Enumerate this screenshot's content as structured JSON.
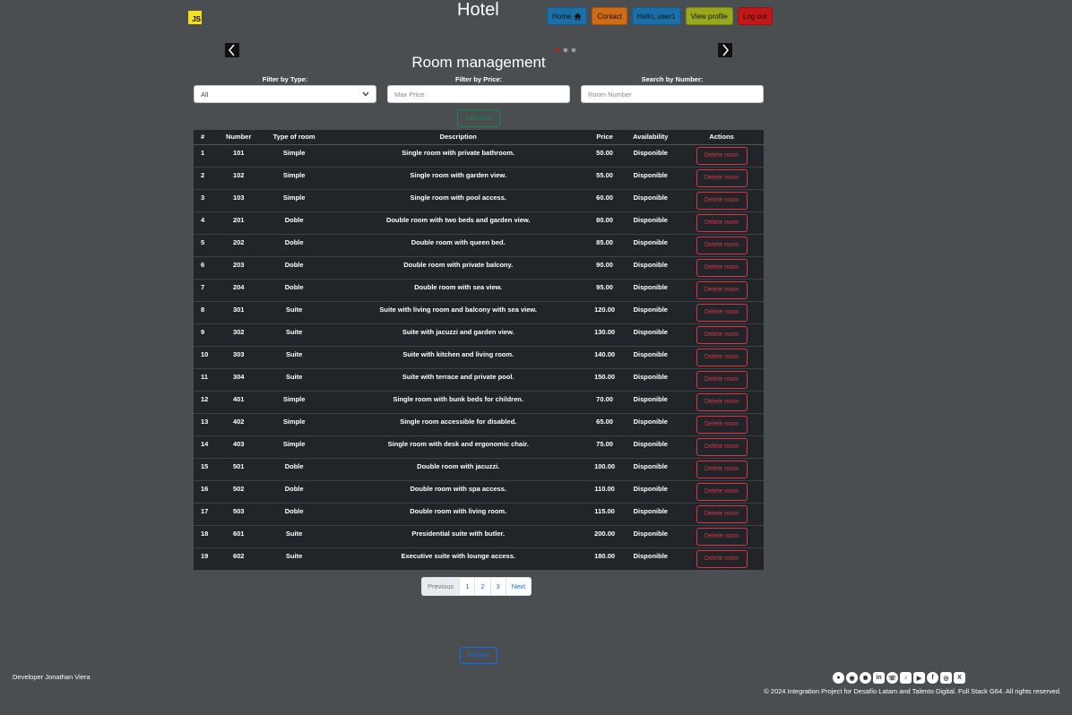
{
  "brand": {
    "logo_text": "JS",
    "title": "Hotel"
  },
  "nav": [
    {
      "label": "Home",
      "color": "#1b6fa8",
      "icon": "home-icon"
    },
    {
      "label": "Contact",
      "color": "#cf6b15",
      "icon": ""
    },
    {
      "label": "Hello, user1",
      "color": "#1b6fa8",
      "icon": ""
    },
    {
      "label": "View profile",
      "color": "#99a81a",
      "icon": ""
    },
    {
      "label": "Log out",
      "color": "#c41818",
      "icon": ""
    }
  ],
  "carousel": {
    "prev_icon": "chevron-left-icon",
    "next_icon": "chevron-right-icon",
    "slides": 3,
    "active": 0
  },
  "page": {
    "heading": "Room management"
  },
  "filters": {
    "type": {
      "label": "Filter by Type:",
      "value": "All"
    },
    "price": {
      "label": "Filter by Price:",
      "placeholder": "Max Price"
    },
    "number": {
      "label": "Search by Number:",
      "placeholder": "Room Number"
    }
  },
  "add_room_label": "Add room",
  "table": {
    "headers": [
      "#",
      "Number",
      "Type of room",
      "Description",
      "Price",
      "Availability",
      "Actions"
    ],
    "delete_label": "Delete room",
    "rows": [
      [
        "1",
        "101",
        "Simple",
        "Single room with private bathroom.",
        "50.00",
        "Disponible"
      ],
      [
        "2",
        "102",
        "Simple",
        "Single room with garden view.",
        "55.00",
        "Disponible"
      ],
      [
        "3",
        "103",
        "Simple",
        "Single room with pool access.",
        "60.00",
        "Disponible"
      ],
      [
        "4",
        "201",
        "Doble",
        "Double room with two beds and garden view.",
        "80.00",
        "Disponible"
      ],
      [
        "5",
        "202",
        "Doble",
        "Double room with queen bed.",
        "85.00",
        "Disponible"
      ],
      [
        "6",
        "203",
        "Doble",
        "Double room with private balcony.",
        "90.00",
        "Disponible"
      ],
      [
        "7",
        "204",
        "Doble",
        "Double room with sea view.",
        "95.00",
        "Disponible"
      ],
      [
        "8",
        "301",
        "Suite",
        "Suite with living room and balcony with sea view.",
        "120.00",
        "Disponible"
      ],
      [
        "9",
        "302",
        "Suite",
        "Suite with jacuzzi and garden view.",
        "130.00",
        "Disponible"
      ],
      [
        "10",
        "303",
        "Suite",
        "Suite with kitchen and living room.",
        "140.00",
        "Disponible"
      ],
      [
        "11",
        "304",
        "Suite",
        "Suite with terrace and private pool.",
        "150.00",
        "Disponible"
      ],
      [
        "12",
        "401",
        "Simple",
        "Single room with bunk beds for children.",
        "70.00",
        "Disponible"
      ],
      [
        "13",
        "402",
        "Simple",
        "Single room accessible for disabled.",
        "65.00",
        "Disponible"
      ],
      [
        "14",
        "403",
        "Simple",
        "Single room with desk and ergonomic chair.",
        "75.00",
        "Disponible"
      ],
      [
        "15",
        "501",
        "Doble",
        "Double room with jacuzzi.",
        "100.00",
        "Disponible"
      ],
      [
        "16",
        "502",
        "Doble",
        "Double room with spa access.",
        "110.00",
        "Disponible"
      ],
      [
        "17",
        "503",
        "Doble",
        "Double room with living room.",
        "115.00",
        "Disponible"
      ],
      [
        "18",
        "601",
        "Suite",
        "Presidential suite with butler.",
        "200.00",
        "Disponible"
      ],
      [
        "19",
        "602",
        "Suite",
        "Executive suite with lounge access.",
        "180.00",
        "Disponible"
      ]
    ]
  },
  "pagination": {
    "prev": "Previous",
    "pages": [
      "1",
      "2",
      "3"
    ],
    "next": "Next"
  },
  "footer": {
    "contact_label": "Contact",
    "developer": "Developer Jonathan Viera",
    "socials": [
      "github-icon",
      "discord-icon",
      "openai-icon",
      "linkedin-icon",
      "whatsapp-icon",
      "tiktok-icon",
      "youtube-icon",
      "facebook-icon",
      "instagram-icon",
      "x-icon"
    ],
    "copyright": "© 2024 Integration Project for Desafío Latam and Talento Digital. Full Stack G64. All rights reserved."
  }
}
